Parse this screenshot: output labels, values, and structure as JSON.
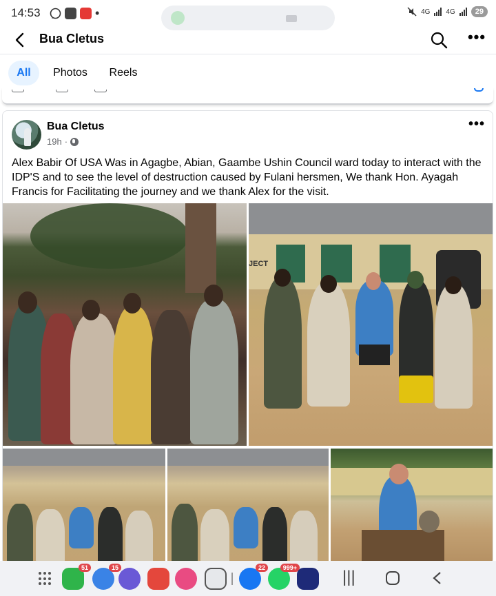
{
  "status_bar": {
    "time": "14:53",
    "network_1": "4G",
    "network_2": "4G",
    "battery": "29"
  },
  "header": {
    "title": "Bua Cletus",
    "back_icon": "arrow-left-icon",
    "search_icon": "search-icon",
    "more_icon": "more-icon"
  },
  "tabs": [
    {
      "label": "All",
      "active": true
    },
    {
      "label": "Photos",
      "active": false
    },
    {
      "label": "Reels",
      "active": false
    }
  ],
  "post": {
    "author": "Bua Cletus",
    "time": "19h",
    "separator": "·",
    "privacy_icon": "globe-icon",
    "text": "Alex Babir Of USA Was in Agagbe,  Abian, Gaambe Ushin Council ward today to interact with the IDP'S and to see the level of destruction caused by Fulani hersmen, We thank Hon. Ayagah Francis for Facilitating the journey and we thank Alex for the visit.",
    "photos": [
      "crowd-photo",
      "group-photo",
      "group-photo-2",
      "group-photo-3",
      "man-with-monkey-photo"
    ],
    "overlay_text": "JECT"
  },
  "bottom_nav": {
    "apps": [
      {
        "name": "phone-app",
        "badge": "51",
        "color": "#2fb44a"
      },
      {
        "name": "messages-app",
        "badge": "15",
        "color": "#3a83e6"
      },
      {
        "name": "browser-app",
        "badge": "",
        "color": "#6a59d6"
      },
      {
        "name": "notes-app",
        "badge": "",
        "color": "#e4473c"
      },
      {
        "name": "gallery-app",
        "badge": "",
        "color": "#e94b82"
      },
      {
        "name": "camera-app",
        "badge": "",
        "color": "#e6e8eb"
      },
      {
        "name": "facebook-app",
        "badge": "22",
        "color": "#1877f2"
      },
      {
        "name": "whatsapp-app",
        "badge": "999+",
        "color": "#25d366"
      },
      {
        "name": "unknown-app",
        "badge": "",
        "color": "#1e2a78"
      }
    ]
  }
}
